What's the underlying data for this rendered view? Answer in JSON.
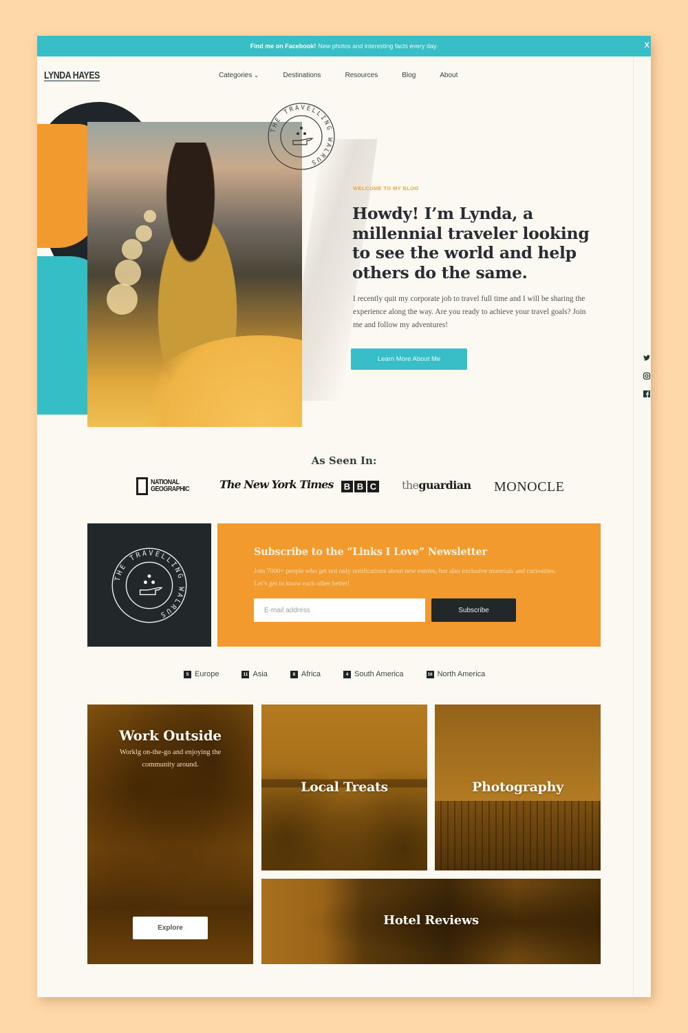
{
  "announcement": {
    "bold": "Find me on Facebook!",
    "text": "New photos and interesting facts every day.",
    "close": "X"
  },
  "header": {
    "logo": "LYNDA HAYES",
    "nav": [
      {
        "label": "Categories",
        "has_dropdown": true
      },
      {
        "label": "Destinations"
      },
      {
        "label": "Resources"
      },
      {
        "label": "Blog"
      },
      {
        "label": "About"
      }
    ],
    "search_icon": "search-icon"
  },
  "social": [
    {
      "name": "twitter-icon",
      "glyph": "🐦"
    },
    {
      "name": "instagram-icon",
      "glyph": "◎"
    },
    {
      "name": "facebook-icon",
      "glyph": "f"
    }
  ],
  "hero": {
    "eyebrow": "WELCOME TO MY BLOG",
    "headline": "Howdy! I’m Lynda, a millennial traveler looking to see the world and help others do the same.",
    "intro": "I recently quit my corporate job to travel full time and I will be sharing the experience along the way. Are you ready to achieve your travel goals?  Join me and follow my adventures!",
    "cta": "Learn More About Me",
    "stamp_text": "THE TRAVELLING WALRUS"
  },
  "as_seen_in": {
    "title": "As Seen In:",
    "logos": {
      "natgeo_line1": "NATIONAL",
      "natgeo_line2": "GEOGRAPHIC",
      "nyt": "The New York Times",
      "bbc": [
        "B",
        "B",
        "C"
      ],
      "guardian_the": "the",
      "guardian_name": "guardian",
      "monocle": "MONOCLE"
    }
  },
  "newsletter": {
    "title": "Subscribe to the “Links I Love” Newsletter",
    "description": "Join 7000+ people who get not only notifications about new entries, but also exclusive materials and curiosities. Let’s get to know each other better!",
    "email_placeholder": "E-mail address",
    "email_value": "",
    "button": "Subscribe",
    "badge_text": "THE TRAVELLING WALRUS"
  },
  "regions": [
    {
      "count": "5",
      "label": "Europe"
    },
    {
      "count": "11",
      "label": "Asia"
    },
    {
      "count": "8",
      "label": "Africa"
    },
    {
      "count": "4",
      "label": "South America"
    },
    {
      "count": "16",
      "label": "North America"
    }
  ],
  "tiles": [
    {
      "title": "Work Outside",
      "subtitle": "Worklg on-the-go and enjoying the community around.",
      "button": "Explore"
    },
    {
      "title": "Local Treats"
    },
    {
      "title": "Photography"
    },
    {
      "title": "Hotel Reviews"
    }
  ],
  "colors": {
    "teal": "#38bec6",
    "orange": "#f29a2e",
    "dark": "#22272a",
    "page_bg": "#fcf9f2",
    "outer_bg": "#fed8a8"
  }
}
